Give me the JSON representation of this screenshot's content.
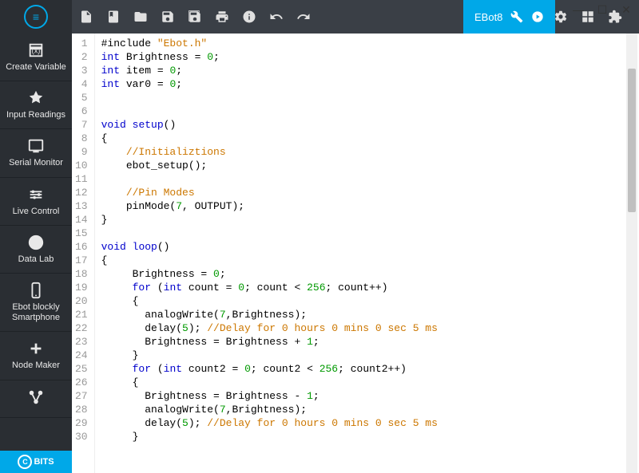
{
  "tab": {
    "label": "EBot8"
  },
  "sidebar": {
    "items": [
      {
        "label": "Create Variable"
      },
      {
        "label": "Input Readings"
      },
      {
        "label": "Serial Monitor"
      },
      {
        "label": "Live Control"
      },
      {
        "label": "Data Lab"
      },
      {
        "label": "Ebot blockly Smartphone"
      },
      {
        "label": "Node Maker"
      },
      {
        "label": " "
      }
    ]
  },
  "footer": {
    "label": "BITS"
  },
  "code": {
    "lines": [
      {
        "n": 1,
        "t": [
          [
            "fn",
            "#include "
          ],
          [
            "str",
            "\"Ebot.h\""
          ]
        ]
      },
      {
        "n": 2,
        "t": [
          [
            "kw",
            "int"
          ],
          [
            "fn",
            " Brightness = "
          ],
          [
            "num",
            "0"
          ],
          [
            "fn",
            ";"
          ]
        ]
      },
      {
        "n": 3,
        "t": [
          [
            "kw",
            "int"
          ],
          [
            "fn",
            " item = "
          ],
          [
            "num",
            "0"
          ],
          [
            "fn",
            ";"
          ]
        ]
      },
      {
        "n": 4,
        "t": [
          [
            "kw",
            "int"
          ],
          [
            "fn",
            " var0 = "
          ],
          [
            "num",
            "0"
          ],
          [
            "fn",
            ";"
          ]
        ]
      },
      {
        "n": 5,
        "t": []
      },
      {
        "n": 6,
        "t": []
      },
      {
        "n": 7,
        "t": [
          [
            "kw",
            "void"
          ],
          [
            "fn",
            " "
          ],
          [
            "kw",
            "setup"
          ],
          [
            "fn",
            "()"
          ]
        ]
      },
      {
        "n": 8,
        "t": [
          [
            "fn",
            "{"
          ]
        ]
      },
      {
        "n": 9,
        "t": [
          [
            "fn",
            "    "
          ],
          [
            "cmt",
            "//Initializtions"
          ]
        ]
      },
      {
        "n": 10,
        "t": [
          [
            "fn",
            "    ebot_setup();"
          ]
        ]
      },
      {
        "n": 11,
        "t": []
      },
      {
        "n": 12,
        "t": [
          [
            "fn",
            "    "
          ],
          [
            "cmt",
            "//Pin Modes"
          ]
        ]
      },
      {
        "n": 13,
        "t": [
          [
            "fn",
            "    pinMode("
          ],
          [
            "num",
            "7"
          ],
          [
            "fn",
            ", OUTPUT);"
          ]
        ]
      },
      {
        "n": 14,
        "t": [
          [
            "fn",
            "}"
          ]
        ]
      },
      {
        "n": 15,
        "t": []
      },
      {
        "n": 16,
        "t": [
          [
            "kw",
            "void"
          ],
          [
            "fn",
            " "
          ],
          [
            "kw",
            "loop"
          ],
          [
            "fn",
            "()"
          ]
        ]
      },
      {
        "n": 17,
        "t": [
          [
            "fn",
            "{"
          ]
        ]
      },
      {
        "n": 18,
        "t": [
          [
            "fn",
            "     Brightness = "
          ],
          [
            "num",
            "0"
          ],
          [
            "fn",
            ";"
          ]
        ]
      },
      {
        "n": 19,
        "t": [
          [
            "fn",
            "     "
          ],
          [
            "kw",
            "for"
          ],
          [
            "fn",
            " ("
          ],
          [
            "kw",
            "int"
          ],
          [
            "fn",
            " count = "
          ],
          [
            "num",
            "0"
          ],
          [
            "fn",
            "; count < "
          ],
          [
            "num",
            "256"
          ],
          [
            "fn",
            "; count++)"
          ]
        ]
      },
      {
        "n": 20,
        "t": [
          [
            "fn",
            "     {"
          ]
        ]
      },
      {
        "n": 21,
        "t": [
          [
            "fn",
            "       analogWrite("
          ],
          [
            "num",
            "7"
          ],
          [
            "fn",
            ",Brightness);"
          ]
        ]
      },
      {
        "n": 22,
        "t": [
          [
            "fn",
            "       delay("
          ],
          [
            "num",
            "5"
          ],
          [
            "fn",
            "); "
          ],
          [
            "cmt",
            "//Delay for 0 hours 0 mins 0 sec 5 ms"
          ]
        ]
      },
      {
        "n": 23,
        "t": [
          [
            "fn",
            "       Brightness = Brightness + "
          ],
          [
            "num",
            "1"
          ],
          [
            "fn",
            ";"
          ]
        ]
      },
      {
        "n": 24,
        "t": [
          [
            "fn",
            "     }"
          ]
        ]
      },
      {
        "n": 25,
        "t": [
          [
            "fn",
            "     "
          ],
          [
            "kw",
            "for"
          ],
          [
            "fn",
            " ("
          ],
          [
            "kw",
            "int"
          ],
          [
            "fn",
            " count2 = "
          ],
          [
            "num",
            "0"
          ],
          [
            "fn",
            "; count2 < "
          ],
          [
            "num",
            "256"
          ],
          [
            "fn",
            "; count2++)"
          ]
        ]
      },
      {
        "n": 26,
        "t": [
          [
            "fn",
            "     {"
          ]
        ]
      },
      {
        "n": 27,
        "t": [
          [
            "fn",
            "       Brightness = Brightness - "
          ],
          [
            "num",
            "1"
          ],
          [
            "fn",
            ";"
          ]
        ]
      },
      {
        "n": 28,
        "t": [
          [
            "fn",
            "       analogWrite("
          ],
          [
            "num",
            "7"
          ],
          [
            "fn",
            ",Brightness);"
          ]
        ]
      },
      {
        "n": 29,
        "t": [
          [
            "fn",
            "       delay("
          ],
          [
            "num",
            "5"
          ],
          [
            "fn",
            "); "
          ],
          [
            "cmt",
            "//Delay for 0 hours 0 mins 0 sec 5 ms"
          ]
        ]
      },
      {
        "n": 30,
        "t": [
          [
            "fn",
            "     }"
          ]
        ]
      }
    ]
  }
}
